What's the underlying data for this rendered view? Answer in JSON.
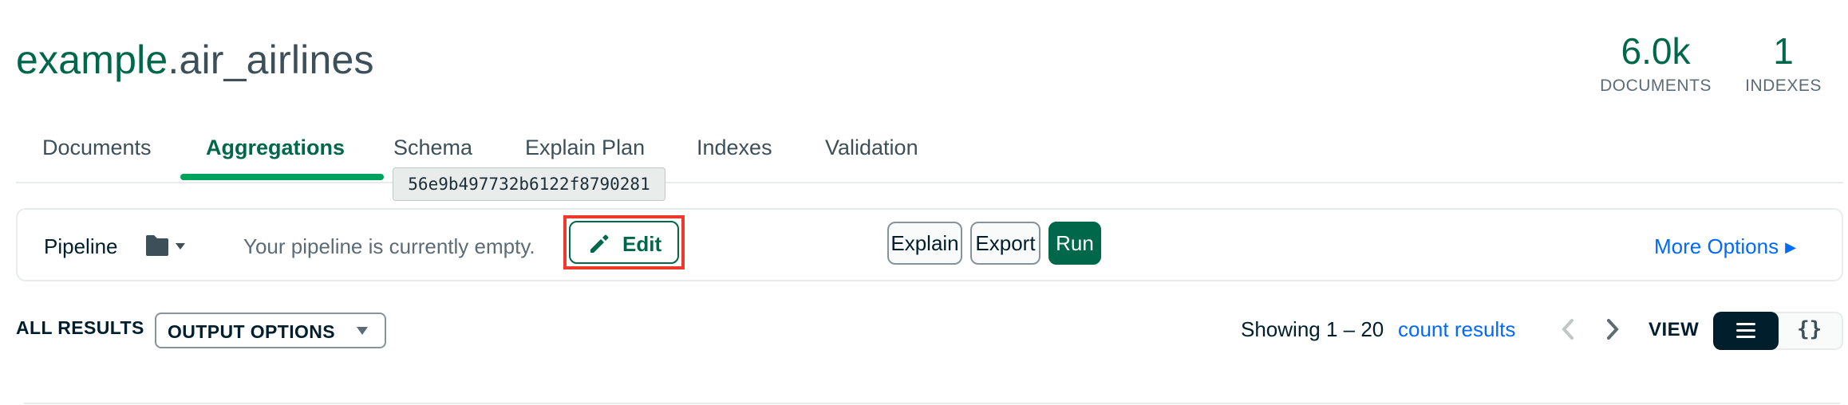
{
  "header": {
    "db_name": "example",
    "collection_name": ".air_airlines",
    "stats": [
      {
        "value": "6.0k",
        "label": "DOCUMENTS"
      },
      {
        "value": "1",
        "label": "INDEXES"
      }
    ]
  },
  "tabs": [
    {
      "label": "Documents"
    },
    {
      "label": "Aggregations",
      "active": true
    },
    {
      "label": "Schema"
    },
    {
      "label": "Explain Plan"
    },
    {
      "label": "Indexes"
    },
    {
      "label": "Validation"
    }
  ],
  "tooltip": "56e9b497732b6122f8790281",
  "toolbar": {
    "pipeline_label": "Pipeline",
    "empty_text": "Your pipeline is currently empty.",
    "edit_label": "Edit",
    "explain_label": "Explain",
    "export_label": "Export",
    "run_label": "Run",
    "more_options_label": "More Options"
  },
  "results": {
    "all_results_label": "ALL RESULTS",
    "output_options_label": "OUTPUT OPTIONS",
    "showing_text": "Showing 1 – 20",
    "count_results_label": "count results",
    "view_label": "VIEW",
    "json_view_glyph": "{}"
  },
  "colors": {
    "brand_green": "#00684a",
    "accent_green": "#00a35c",
    "link_blue": "#016bf8",
    "highlight_red": "#ee3a2c"
  }
}
